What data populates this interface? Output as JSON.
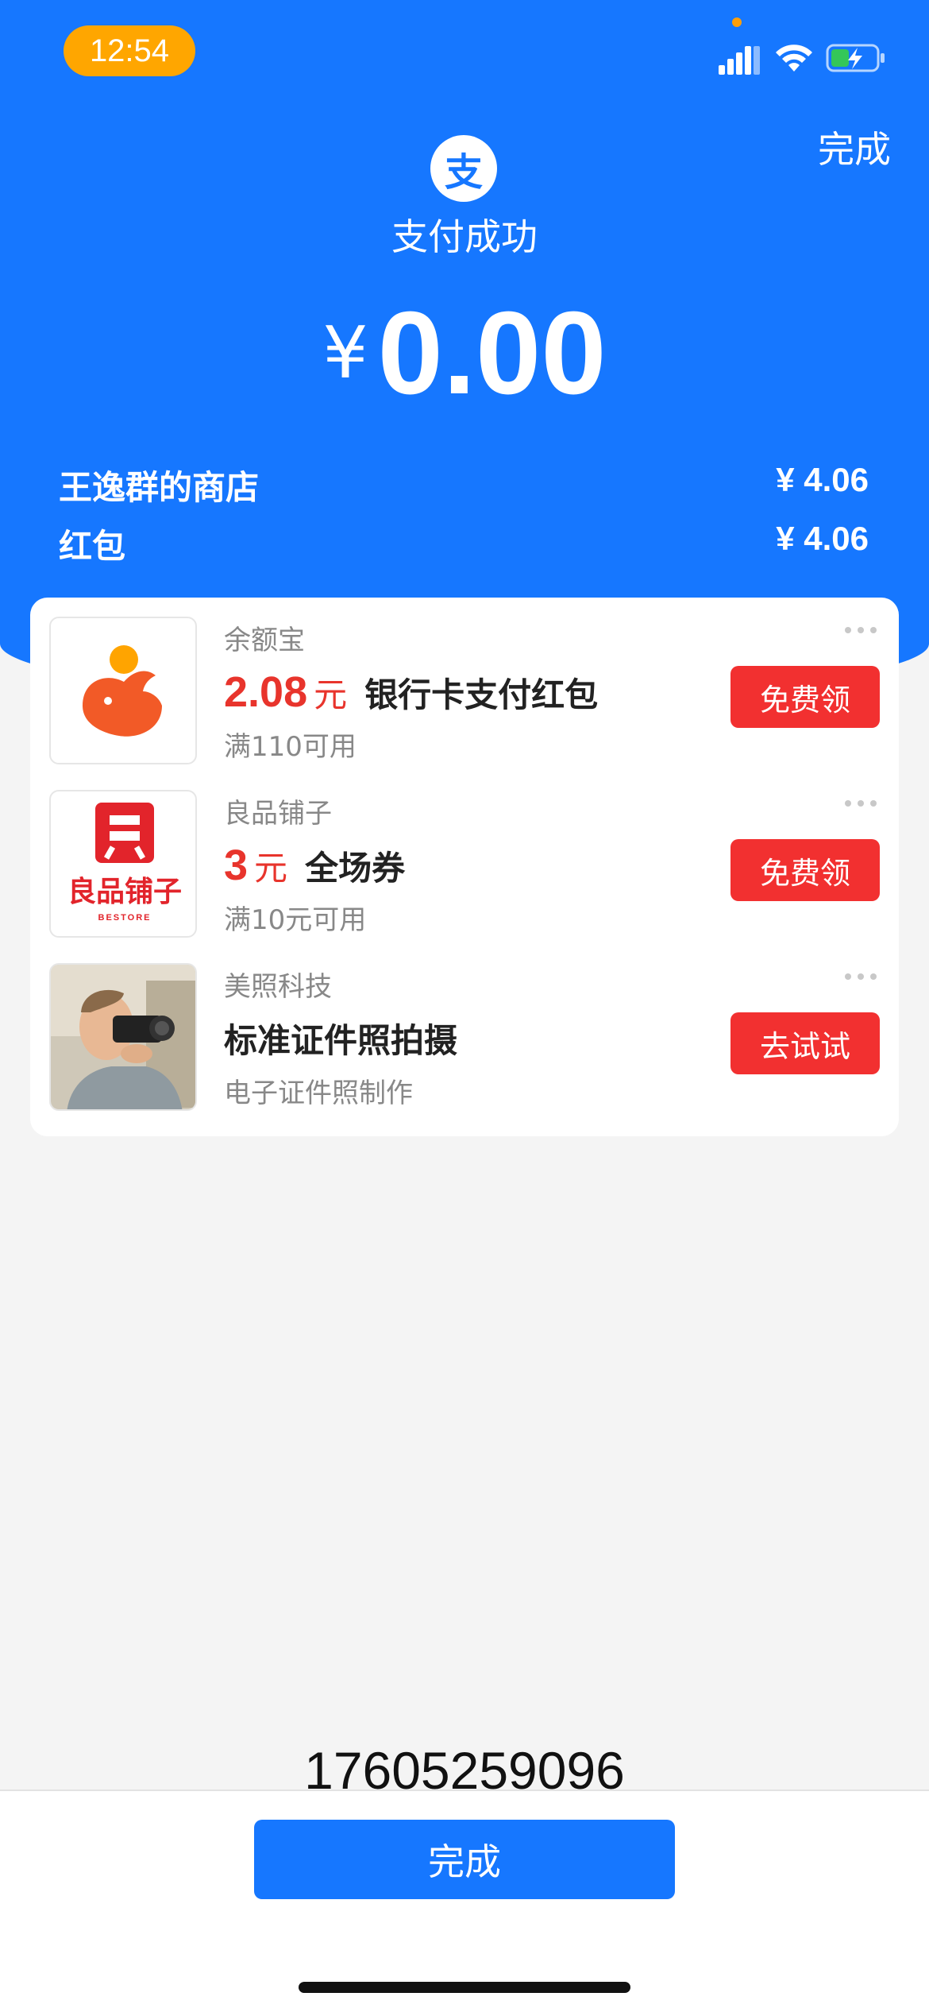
{
  "status_bar": {
    "time": "12:54"
  },
  "header": {
    "done_label": "完成",
    "logo_glyph": "支",
    "title": "支付成功",
    "currency": "¥",
    "amount": "0.00",
    "details": [
      {
        "label": "王逸群的商店",
        "value": "¥ 4.06"
      },
      {
        "label": "红包",
        "value": "¥ 4.06"
      }
    ]
  },
  "offers": [
    {
      "brand": "余额宝",
      "amount": "2.08",
      "unit": "元",
      "title": "银行卡支付红包",
      "condition": "满110可用",
      "cta": "免费领",
      "icon": "yuebao-logo-icon"
    },
    {
      "brand": "良品铺子",
      "amount": "3",
      "unit": "元",
      "title": "全场券",
      "condition": "满10元可用",
      "cta": "免费领",
      "icon": "bestore-logo-icon",
      "logo_text": "良品铺子",
      "logo_sub": "BESTORE"
    },
    {
      "brand": "美照科技",
      "title": "标准证件照拍摄",
      "condition": "电子证件照制作",
      "cta": "去试试",
      "icon": "photographer-photo"
    }
  ],
  "phone_number": "17605259096",
  "footer": {
    "done_label": "完成"
  },
  "colors": {
    "primary": "#1677ff",
    "accent_red": "#f23030",
    "time_pill": "#ffa600"
  }
}
